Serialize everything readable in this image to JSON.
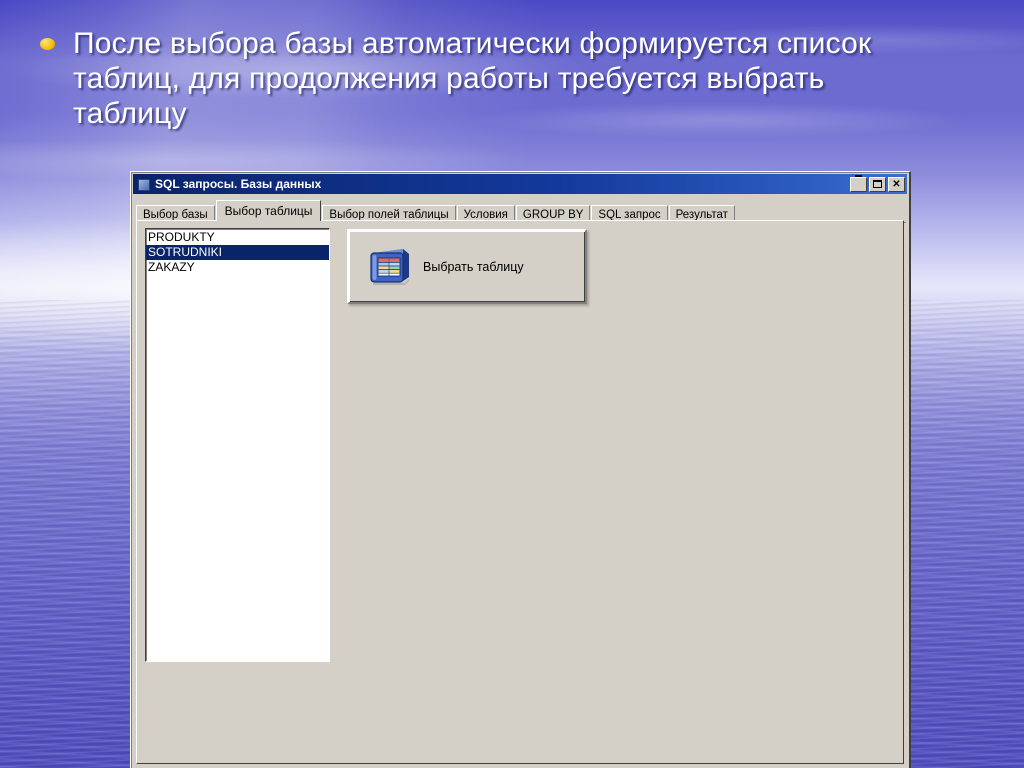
{
  "slide": {
    "bullet_text": "После выбора базы автоматически формируется список таблиц, для продолжения работы требуется выбрать таблицу",
    "bullet_marker": "bullet-dot",
    "background_colors": {
      "sky_top": "#4a49c4",
      "horizon": "#e6e6fa",
      "water_bottom": "#4e4dbe"
    }
  },
  "window": {
    "title": "SQL запросы. Базы данных",
    "title_icon": "app-icon",
    "titlebar_color": "#0a246a",
    "face_color": "#d4d0c8",
    "controls": {
      "minimize": "_",
      "maximize": "□",
      "close": "✕"
    },
    "tabs": [
      {
        "label": "Выбор базы",
        "selected": false
      },
      {
        "label": "Выбор таблицы",
        "selected": true
      },
      {
        "label": "Выбор полей таблицы",
        "selected": false
      },
      {
        "label": "Условия",
        "selected": false
      },
      {
        "label": "GROUP BY",
        "selected": false
      },
      {
        "label": "SQL запрос",
        "selected": false
      },
      {
        "label": "Результат",
        "selected": false
      }
    ],
    "tables_list": {
      "items": [
        {
          "label": "PRODUKTY",
          "selected": false
        },
        {
          "label": "SOTRUDNIKI",
          "selected": true
        },
        {
          "label": "ZAKAZY",
          "selected": false
        }
      ],
      "selection_color": "#0a246a",
      "selection_text_color": "#ffffff"
    },
    "select_table_button": {
      "label": "Выбрать таблицу",
      "icon": "table-3d-icon"
    }
  }
}
